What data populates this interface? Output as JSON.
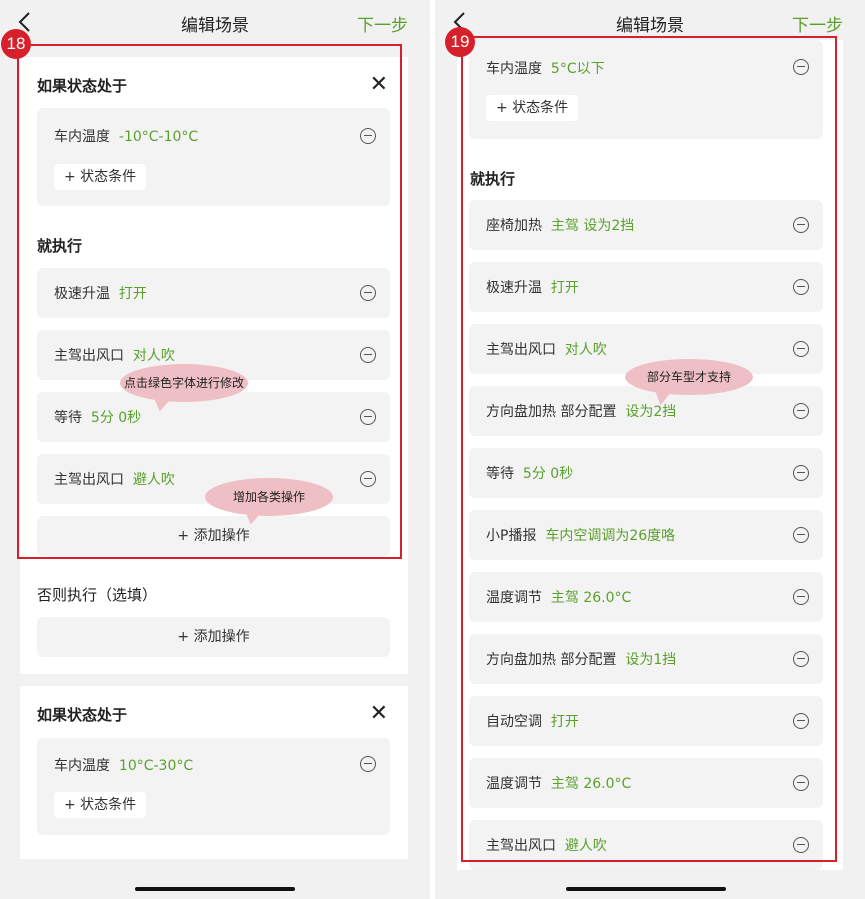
{
  "header": {
    "title": "编辑场景",
    "next_label": "下一步"
  },
  "left": {
    "badge": "18",
    "condition_section": {
      "title": "如果状态处于",
      "close": "✕",
      "condition": {
        "label": "车内温度",
        "value": "-10°C-10°C"
      },
      "add_condition": "+ 状态条件"
    },
    "execute_section": {
      "title": "就执行",
      "actions": [
        {
          "label": "极速升温",
          "value": "打开"
        },
        {
          "label": "主驾出风口",
          "value": "对人吹"
        },
        {
          "label": "等待",
          "value": "5分 0秒"
        },
        {
          "label": "主驾出风口",
          "value": "避人吹"
        }
      ],
      "add_action": "+ 添加操作"
    },
    "else_section": {
      "title": "否则执行（选填）",
      "add_action": "+ 添加操作"
    },
    "condition_section_2": {
      "title": "如果状态处于",
      "close": "✕",
      "condition": {
        "label": "车内温度",
        "value": "10°C-30°C"
      },
      "add_condition": "+ 状态条件"
    },
    "annotations": {
      "green_text_tip": "点击绿色字体进行修改",
      "add_tip": "增加各类操作"
    }
  },
  "right": {
    "badge": "19",
    "condition": {
      "label": "车内温度",
      "value": "5°C以下"
    },
    "add_condition": "+ 状态条件",
    "execute_title": "就执行",
    "actions": [
      {
        "label": "座椅加热",
        "value": "主驾 设为2挡"
      },
      {
        "label": "极速升温",
        "value": "打开"
      },
      {
        "label": "主驾出风口",
        "value": "对人吹"
      },
      {
        "label": "方向盘加热 部分配置",
        "value": "设为2挡"
      },
      {
        "label": "等待",
        "value": "5分 0秒"
      },
      {
        "label": "小P播报",
        "value": "车内空调调为26度咯"
      },
      {
        "label": "温度调节",
        "value": "主驾 26.0°C"
      },
      {
        "label": "方向盘加热 部分配置",
        "value": "设为1挡"
      },
      {
        "label": "自动空调",
        "value": "打开"
      },
      {
        "label": "温度调节",
        "value": "主驾 26.0°C"
      },
      {
        "label": "主驾出风口",
        "value": "避人吹"
      }
    ],
    "annotations": {
      "model_tip": "部分车型才支持"
    }
  },
  "colors": {
    "accent_green": "#5aa02c",
    "annotation_red": "#d6202b",
    "bubble_pink": "#eebfc4"
  }
}
